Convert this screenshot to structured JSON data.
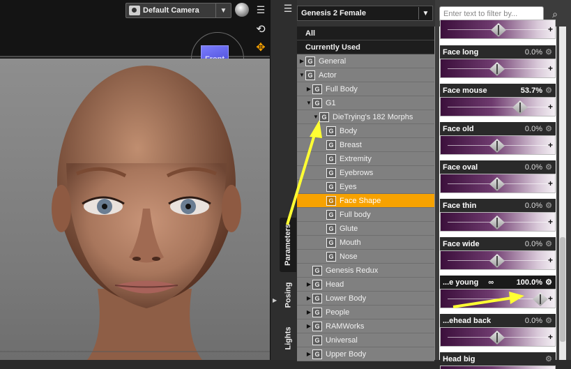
{
  "viewport": {
    "camera": "Default Camera",
    "nav_cube_label": "Front"
  },
  "side_tabs": {
    "parameters": "Parameters",
    "posing": "Posing",
    "lights": "Lights"
  },
  "tree": {
    "figure": "Genesis 2 Female",
    "top_items": [
      "All",
      "Currently Used"
    ],
    "groups": [
      {
        "label": "General",
        "depth": 0,
        "expanded": false
      },
      {
        "label": "Actor",
        "depth": 0,
        "expanded": true
      },
      {
        "label": "Full Body",
        "depth": 1,
        "expanded": false
      },
      {
        "label": "G1",
        "depth": 1,
        "expanded": true
      },
      {
        "label": "DieTrying's 182 Morphs",
        "depth": 2,
        "expanded": true
      },
      {
        "label": "Body",
        "depth": 3
      },
      {
        "label": "Breast",
        "depth": 3
      },
      {
        "label": "Extremity",
        "depth": 3
      },
      {
        "label": "Eyebrows",
        "depth": 3
      },
      {
        "label": "Eyes",
        "depth": 3
      },
      {
        "label": "Face Shape",
        "depth": 3,
        "selected": true
      },
      {
        "label": "Full body",
        "depth": 3
      },
      {
        "label": "Glute",
        "depth": 3
      },
      {
        "label": "Mouth",
        "depth": 3
      },
      {
        "label": "Nose",
        "depth": 3
      },
      {
        "label": "Genesis Redux",
        "depth": 1
      },
      {
        "label": "Head",
        "depth": 1,
        "expanded": false
      },
      {
        "label": "Lower Body",
        "depth": 1,
        "expanded": false
      },
      {
        "label": "People",
        "depth": 1,
        "expanded": false
      },
      {
        "label": "RAMWorks",
        "depth": 1,
        "expanded": false
      },
      {
        "label": "Universal",
        "depth": 1
      },
      {
        "label": "Upper Body",
        "depth": 1,
        "expanded": false
      }
    ]
  },
  "filter": {
    "placeholder": "Enter text to filter by..."
  },
  "sliders": [
    {
      "label": "Face long",
      "value": "0.0%",
      "fraction": 0.5
    },
    {
      "label": "Face mouse",
      "value": "53.7%",
      "fraction": 0.77
    },
    {
      "label": "Face old",
      "value": "0.0%",
      "fraction": 0.5
    },
    {
      "label": "Face oval",
      "value": "0.0%",
      "fraction": 0.5
    },
    {
      "label": "Face thin",
      "value": "0.0%",
      "fraction": 0.5
    },
    {
      "label": "Face wide",
      "value": "0.0%",
      "fraction": 0.5
    },
    {
      "label": "...e young",
      "value": "100.0%",
      "fraction": 1.0,
      "linked": true
    },
    {
      "label": "...ehead back",
      "value": "0.0%",
      "fraction": 0.5
    },
    {
      "label": "Head big",
      "value": "",
      "fraction": 0.5
    }
  ],
  "colors": {
    "selected_row": "#f7a200",
    "annotation_arrow": "#ffff33"
  }
}
